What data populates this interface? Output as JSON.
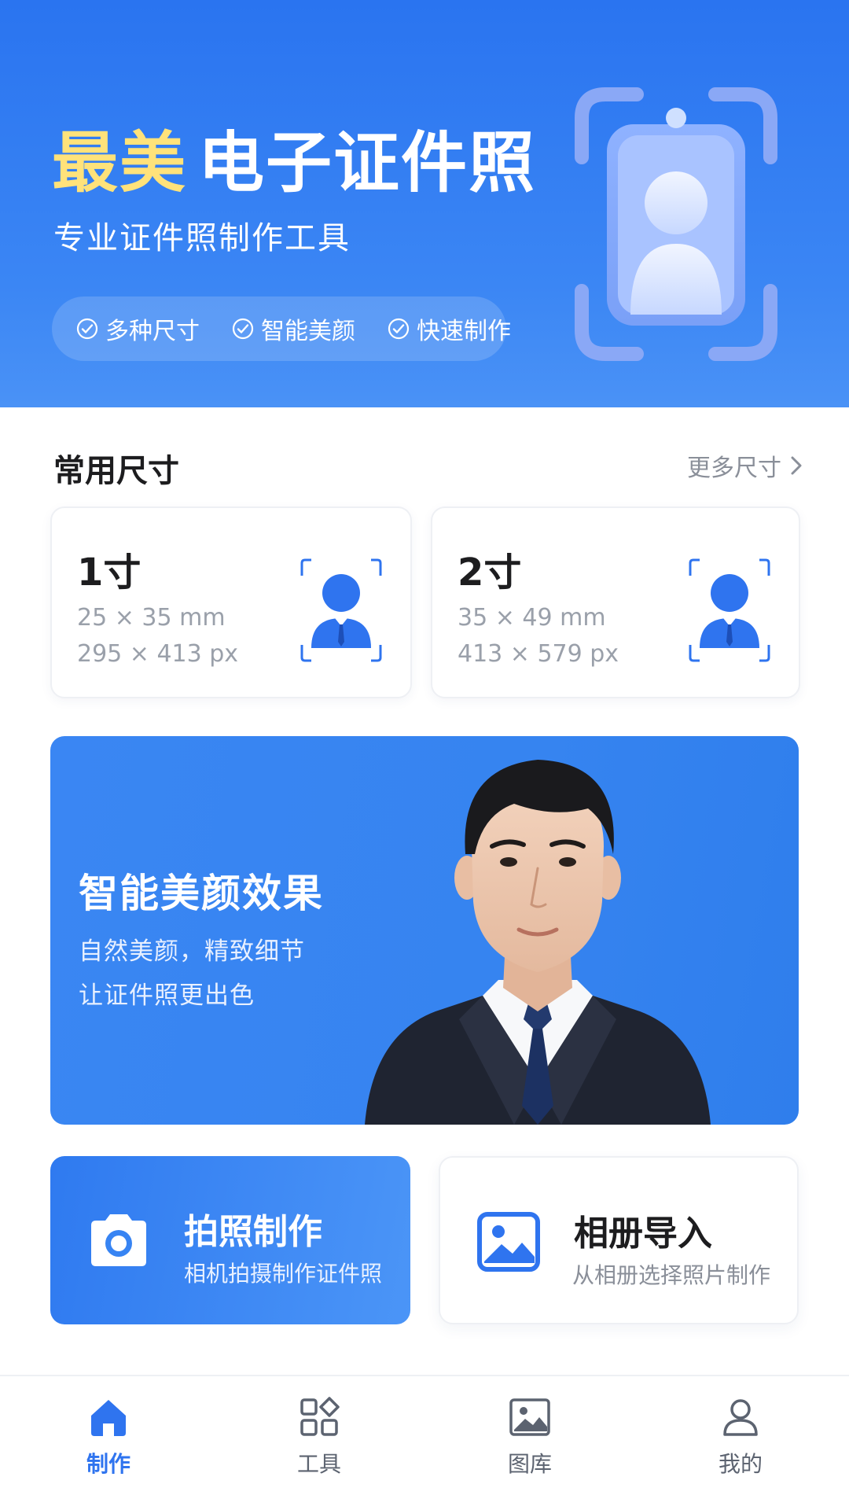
{
  "hero": {
    "title_accent": "最美",
    "title_rest": "电子证件照",
    "subtitle": "专业证件照制作工具",
    "features": [
      "多种尺寸",
      "智能美颜",
      "快速制作"
    ]
  },
  "common_sizes": {
    "title": "常用尺寸",
    "more_label": "更多尺寸",
    "items": [
      {
        "name": "1寸",
        "mm": "25 × 35 mm",
        "px": "295 × 413 px"
      },
      {
        "name": "2寸",
        "mm": "35 × 49 mm",
        "px": "413 × 579 px"
      }
    ]
  },
  "banner": {
    "title": "智能美颜效果",
    "line1": "自然美颜，精致细节",
    "line2": "让证件照更出色"
  },
  "actions": {
    "camera": {
      "title": "拍照制作",
      "subtitle": "相机拍摄制作证件照",
      "icon": "camera-icon"
    },
    "album": {
      "title": "相册导入",
      "subtitle": "从相册选择照片制作",
      "icon": "image-icon"
    }
  },
  "tabbar": {
    "active": "make",
    "items": [
      {
        "key": "make",
        "label": "制作",
        "icon": "home-icon"
      },
      {
        "key": "tools",
        "label": "工具",
        "icon": "apps-icon"
      },
      {
        "key": "gallery",
        "label": "图库",
        "icon": "gallery-icon"
      },
      {
        "key": "me",
        "label": "我的",
        "icon": "user-icon"
      }
    ]
  },
  "colors": {
    "accent": "#2f74ef",
    "highlight": "#ffe27a",
    "text": "#1d1d1f",
    "muted": "#8a8f99"
  }
}
